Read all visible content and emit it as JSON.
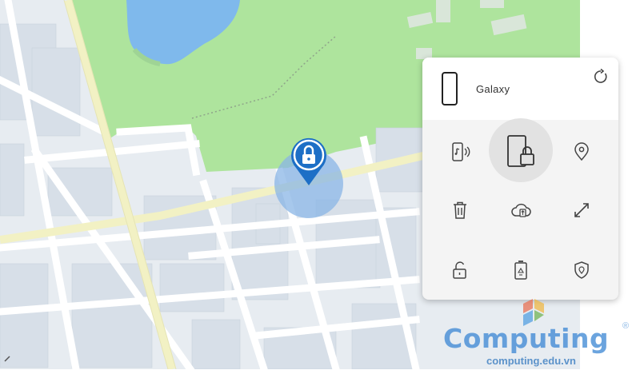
{
  "device": {
    "name": "Galaxy"
  },
  "actions": [
    {
      "id": "ring",
      "icon": "phone-ring-icon",
      "active": false
    },
    {
      "id": "lock",
      "icon": "phone-lock-icon",
      "active": true
    },
    {
      "id": "track-location",
      "icon": "location-pin-icon",
      "active": false
    },
    {
      "id": "erase-data",
      "icon": "trash-icon",
      "active": false
    },
    {
      "id": "back-up",
      "icon": "cloud-backup-icon",
      "active": false
    },
    {
      "id": "retrieve-data",
      "icon": "retrieve-arrows-icon",
      "active": false
    },
    {
      "id": "unlock",
      "icon": "unlock-padlock-icon",
      "active": false
    },
    {
      "id": "extend-battery",
      "icon": "battery-recycle-icon",
      "active": false
    },
    {
      "id": "guardians",
      "icon": "shield-pin-icon",
      "active": false
    }
  ],
  "map": {
    "marker_icon": "lock-pin-icon"
  },
  "watermark": {
    "title": "Computing",
    "url": "computing.edu.vn",
    "registered": "®"
  },
  "colors": {
    "park": "#aee49d",
    "water": "#7fb9ec",
    "road": "#ffffff",
    "arterial": "#f2f1c4",
    "block": "#e7ecf1",
    "building": "#d7dfe8",
    "marker": "#1d6fc6",
    "accuracy_circle": "#8ab6e6"
  }
}
